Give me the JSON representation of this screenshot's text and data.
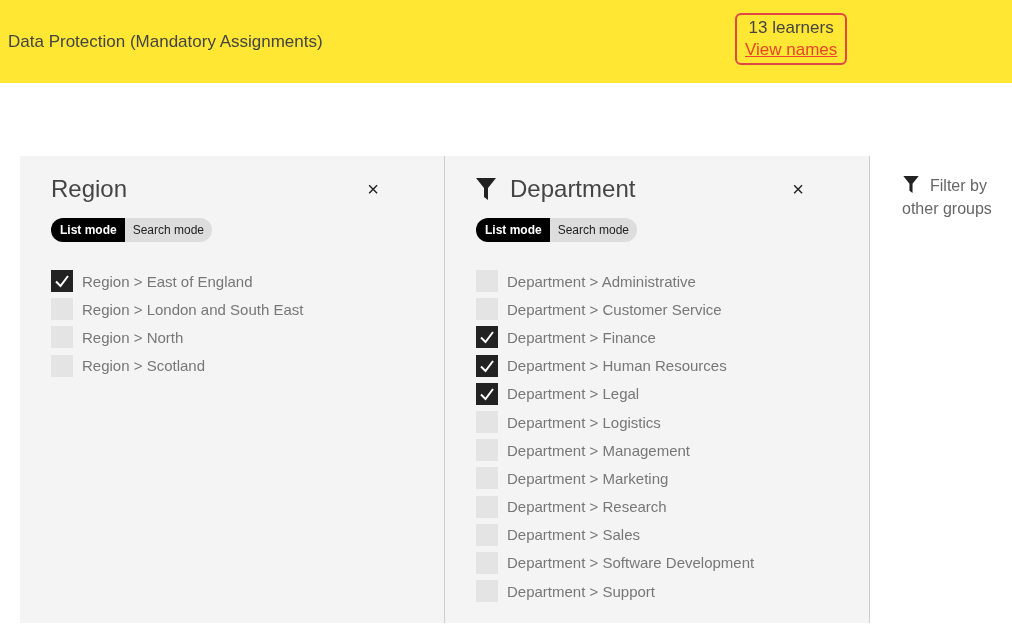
{
  "header": {
    "title": "Data Protection (Mandatory Assignments)",
    "learner_count": "13 learners",
    "view_link": "View names"
  },
  "panels": [
    {
      "title": "Region",
      "filter_icon": false,
      "close": "×",
      "modes": [
        {
          "label": "List mode",
          "selected": true
        },
        {
          "label": "Search mode",
          "selected": false
        }
      ],
      "items": [
        {
          "label": "Region > East of England",
          "checked": true
        },
        {
          "label": "Region > London and South East",
          "checked": false
        },
        {
          "label": "Region > North",
          "checked": false
        },
        {
          "label": "Region > Scotland",
          "checked": false
        }
      ]
    },
    {
      "title": "Department",
      "filter_icon": true,
      "close": "×",
      "modes": [
        {
          "label": "List mode",
          "selected": true
        },
        {
          "label": "Search mode",
          "selected": false
        }
      ],
      "items": [
        {
          "label": "Department > Administrative",
          "checked": false
        },
        {
          "label": "Department > Customer Service",
          "checked": false
        },
        {
          "label": "Department > Finance",
          "checked": true
        },
        {
          "label": "Department > Human Resources",
          "checked": true
        },
        {
          "label": "Department > Legal",
          "checked": true
        },
        {
          "label": "Department > Logistics",
          "checked": false
        },
        {
          "label": "Department > Management",
          "checked": false
        },
        {
          "label": "Department > Marketing",
          "checked": false
        },
        {
          "label": "Department > Research",
          "checked": false
        },
        {
          "label": "Department > Sales",
          "checked": false
        },
        {
          "label": "Department > Software Development",
          "checked": false
        },
        {
          "label": "Department > Support",
          "checked": false
        }
      ]
    }
  ],
  "other_groups": {
    "label": "Filter by other groups"
  }
}
